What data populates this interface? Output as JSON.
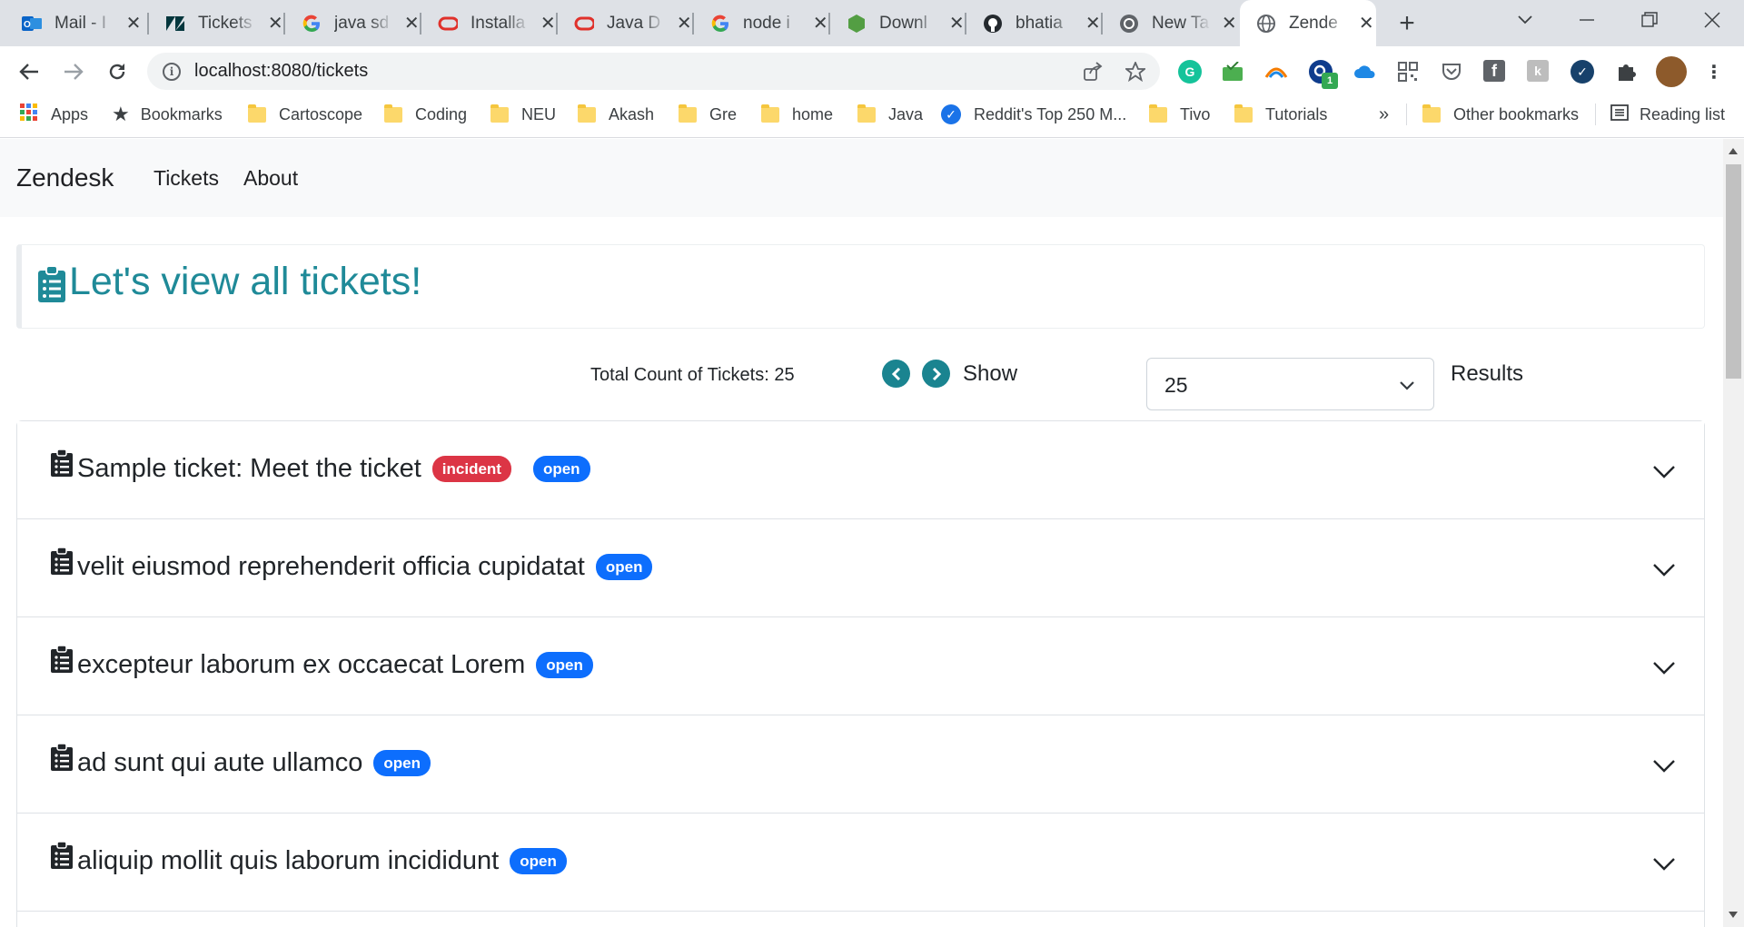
{
  "browser": {
    "tabs": [
      {
        "title": "Mail - I",
        "icon": "outlook-icon"
      },
      {
        "title": "Tickets",
        "icon": "zendesk-icon"
      },
      {
        "title": "java sd",
        "icon": "google-icon"
      },
      {
        "title": "Installa",
        "icon": "oracle-icon"
      },
      {
        "title": "Java D",
        "icon": "oracle-icon"
      },
      {
        "title": "node i",
        "icon": "google-icon"
      },
      {
        "title": "Downl",
        "icon": "nodejs-icon"
      },
      {
        "title": "bhatia",
        "icon": "github-icon"
      },
      {
        "title": "New Ta",
        "icon": "chrome-icon"
      },
      {
        "title": "Zende",
        "icon": "globe-icon"
      }
    ],
    "url": "localhost:8080/tickets",
    "bookmarks": [
      {
        "label": "Apps"
      },
      {
        "label": "Bookmarks"
      },
      {
        "label": "Cartoscope"
      },
      {
        "label": "Coding"
      },
      {
        "label": "NEU"
      },
      {
        "label": "Akash"
      },
      {
        "label": "Gre"
      },
      {
        "label": "home"
      },
      {
        "label": "Java"
      },
      {
        "label": "Reddit's Top 250 M..."
      },
      {
        "label": "Tivo"
      },
      {
        "label": "Tutorials"
      }
    ],
    "overflow": "»",
    "other_bookmarks": "Other bookmarks",
    "reading_list": "Reading list",
    "extension_badge": "1"
  },
  "app": {
    "brand": "Zendesk",
    "nav": [
      "Tickets",
      "About"
    ],
    "heading": "Let's view all tickets!",
    "total_count_label": "Total Count of Tickets: 25",
    "show_label": "Show",
    "page_size": "25",
    "results_label": "Results",
    "tickets": [
      {
        "subject": "Sample ticket: Meet the ticket",
        "type": "incident",
        "status": "open"
      },
      {
        "subject": "velit eiusmod reprehenderit officia cupidatat",
        "type": "",
        "status": "open"
      },
      {
        "subject": "excepteur laborum ex occaecat Lorem",
        "type": "",
        "status": "open"
      },
      {
        "subject": "ad sunt qui aute ullamco",
        "type": "",
        "status": "open"
      },
      {
        "subject": "aliquip mollit quis laborum incididunt",
        "type": "",
        "status": "open"
      }
    ]
  },
  "colors": {
    "heading": "#1f8a98",
    "pager": "#1a8490",
    "badge_incident": "#dc3545",
    "badge_open": "#0d6efd"
  }
}
